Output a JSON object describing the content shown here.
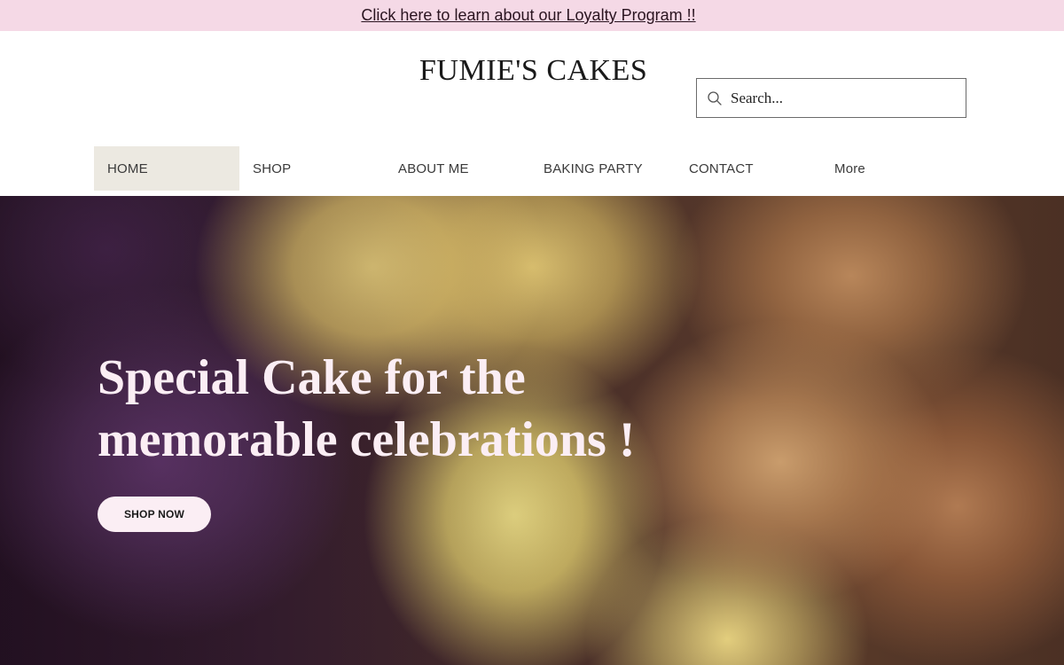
{
  "promo": {
    "link_text": "Click here to learn about our Loyalty Program !!"
  },
  "header": {
    "site_title": "FUMIE'S CAKES",
    "search": {
      "placeholder": "Search...",
      "icon": "search-icon"
    }
  },
  "nav": {
    "items": [
      {
        "label": "HOME",
        "active": true
      },
      {
        "label": "SHOP"
      },
      {
        "label": "ABOUT ME"
      },
      {
        "label": "BAKING PARTY"
      },
      {
        "label": "CONTACT"
      },
      {
        "label": "More"
      }
    ]
  },
  "hero": {
    "title_line1": "Special Cake for the",
    "title_line2": "memorable celebrations !",
    "cta_label": "SHOP NOW"
  },
  "colors": {
    "promo_bg": "#f5d9e6",
    "nav_active_bg": "#ece9e1",
    "hero_text": "#fbeef4"
  }
}
